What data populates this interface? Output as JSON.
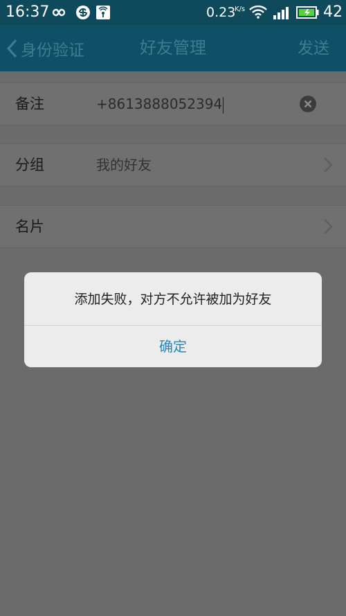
{
  "status_bar": {
    "time": "16:37",
    "net_speed": "0.23",
    "net_speed_unit": "K/s",
    "battery": "42",
    "icons": [
      "infinity-icon",
      "sync-icon",
      "app-notification-icon",
      "wifi-icon",
      "signal-icon",
      "battery-icon"
    ]
  },
  "nav": {
    "back_label": "身份验证",
    "title": "好友管理",
    "send_label": "发送"
  },
  "form": {
    "remark_label": "备注",
    "remark_value": "+8613888052394",
    "group_label": "分组",
    "group_value": "我的好友",
    "card_label": "名片"
  },
  "dialog": {
    "message": "添加失败，对方不允许被加为好友",
    "confirm_label": "确定"
  },
  "colors": {
    "statusbar": "#0f4a5c",
    "navbar": "#105066",
    "dialog_bg": "#ececec",
    "dialog_button": "#1b8bc6",
    "overlay": "#6b6b6b"
  }
}
